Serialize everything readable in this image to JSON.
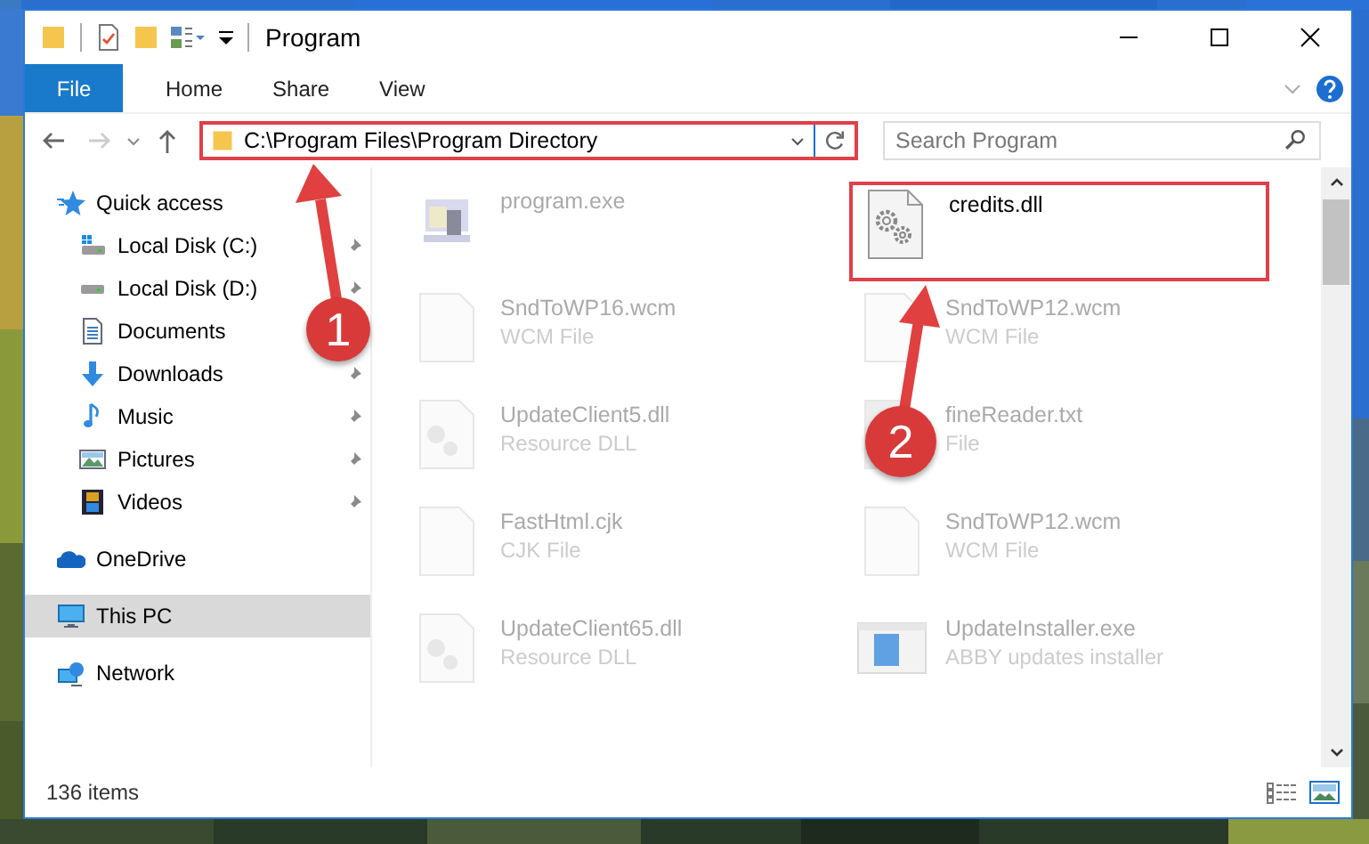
{
  "window": {
    "title": "Program"
  },
  "ribbon_tabs": [
    {
      "label": "File",
      "kind": "file",
      "selected": false
    },
    {
      "label": "Home",
      "kind": "tab",
      "selected": false
    },
    {
      "label": "Share",
      "kind": "tab",
      "selected": false
    },
    {
      "label": "View",
      "kind": "tab",
      "selected": false
    }
  ],
  "address_bar": {
    "path": "C:\\Program Files\\Program Directory",
    "highlighted": true
  },
  "search": {
    "placeholder": "Search Program"
  },
  "sidebar": {
    "items": [
      {
        "label": "Quick access",
        "kind": "star",
        "selected": false,
        "children": [
          {
            "label": "Local Disk (C:)",
            "kind": "system-drive",
            "pinned": true,
            "selected": false
          },
          {
            "label": "Local Disk (D:)",
            "kind": "drive",
            "pinned": true,
            "selected": false
          },
          {
            "label": "Documents",
            "kind": "documents",
            "pinned": false,
            "selected": false
          },
          {
            "label": "Downloads",
            "kind": "downloads",
            "pinned": true,
            "selected": false
          },
          {
            "label": "Music",
            "kind": "music",
            "pinned": true,
            "selected": false
          },
          {
            "label": "Pictures",
            "kind": "pictures",
            "pinned": true,
            "selected": false
          },
          {
            "label": "Videos",
            "kind": "videos",
            "pinned": true,
            "selected": false
          }
        ]
      },
      {
        "label": "OneDrive",
        "kind": "cloud",
        "selected": false
      },
      {
        "label": "This PC",
        "kind": "pc",
        "selected": true
      },
      {
        "label": "Network",
        "kind": "network",
        "selected": false
      }
    ]
  },
  "files": [
    {
      "name": "program.exe",
      "kind": "exe",
      "blurred": true,
      "highlighted": false
    },
    {
      "name": "credits.dll",
      "kind": "dll",
      "blurred": false,
      "highlighted": true
    },
    {
      "name": "SndToWP16.wcm",
      "type": "WCM File",
      "kind": "blank",
      "blurred": true,
      "highlighted": false
    },
    {
      "name": "SndToWP12.wcm",
      "type": "WCM File",
      "kind": "blank",
      "blurred": true,
      "highlighted": false
    },
    {
      "name": "UpdateClient5.dll",
      "type": "Resource DLL",
      "kind": "resource",
      "blurred": true,
      "highlighted": false
    },
    {
      "name": "fineReader.txt",
      "type": "File",
      "kind": "text",
      "blurred": true,
      "highlighted": false
    },
    {
      "name": "FastHtml.cjk",
      "type": "CJK File",
      "kind": "blank",
      "blurred": true,
      "highlighted": false
    },
    {
      "name": "SndToWP12.wcm",
      "type": "WCM File",
      "kind": "blank",
      "blurred": true,
      "highlighted": false
    },
    {
      "name": "UpdateClient65.dll",
      "type": "Resource DLL",
      "kind": "resource",
      "blurred": true,
      "highlighted": false
    },
    {
      "name": "UpdateInstaller.exe",
      "type": "ABBY updates installer",
      "kind": "installer",
      "blurred": true,
      "highlighted": false
    }
  ],
  "status_bar": {
    "item_count": "136 items"
  },
  "annotations": [
    {
      "label": "1"
    },
    {
      "label": "2"
    }
  ]
}
